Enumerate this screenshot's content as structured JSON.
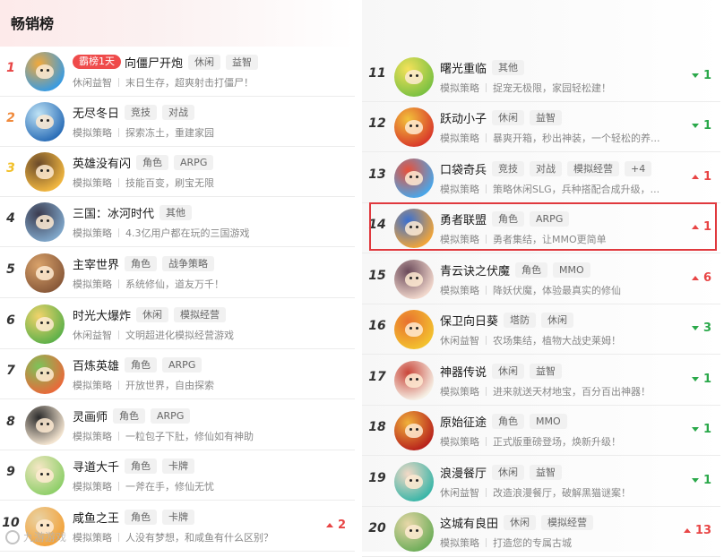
{
  "header": {
    "title": "畅销榜"
  },
  "rankings": [
    {
      "rank": "1",
      "badge": "霸榜1天",
      "name": "向僵尸开炮",
      "tags": [
        "休闲",
        "益智"
      ],
      "category": "休闲益智",
      "desc": "末日生存，超爽射击打僵尸！",
      "trend": null,
      "icon_colors": [
        "#3a9be0",
        "#f2a93b"
      ]
    },
    {
      "rank": "2",
      "badge": null,
      "name": "无尽冬日",
      "tags": [
        "竞技",
        "对战"
      ],
      "category": "模拟策略",
      "desc": "探索冻土，重建家园",
      "trend": null,
      "icon_colors": [
        "#2c6fb8",
        "#bfe3f5"
      ]
    },
    {
      "rank": "3",
      "badge": null,
      "name": "英雄没有闪",
      "tags": [
        "角色",
        "ARPG"
      ],
      "category": "模拟策略",
      "desc": "技能百变，刷宝无限",
      "trend": null,
      "icon_colors": [
        "#f0b640",
        "#6b4a2a"
      ]
    },
    {
      "rank": "4",
      "badge": null,
      "name": "三国：冰河时代",
      "tags": [
        "其他"
      ],
      "category": "模拟策略",
      "desc": "4.3亿用户都在玩的三国游戏",
      "trend": null,
      "icon_colors": [
        "#7fa6c9",
        "#3b3b4f"
      ]
    },
    {
      "rank": "5",
      "badge": null,
      "name": "主宰世界",
      "tags": [
        "角色",
        "战争策略"
      ],
      "category": "模拟策略",
      "desc": "系统修仙，道友万千！",
      "trend": null,
      "icon_colors": [
        "#8a5a3a",
        "#d9a26a"
      ]
    },
    {
      "rank": "6",
      "badge": null,
      "name": "时光大爆炸",
      "tags": [
        "休闲",
        "模拟经营"
      ],
      "category": "休闲益智",
      "desc": "文明超进化模拟经营游戏",
      "trend": null,
      "icon_colors": [
        "#5fb14a",
        "#f2d36b"
      ]
    },
    {
      "rank": "7",
      "badge": null,
      "name": "百炼英雄",
      "tags": [
        "角色",
        "ARPG"
      ],
      "category": "模拟策略",
      "desc": "开放世界，自由探索",
      "trend": null,
      "icon_colors": [
        "#e86a3a",
        "#7cc35a"
      ]
    },
    {
      "rank": "8",
      "badge": null,
      "name": "灵画师",
      "tags": [
        "角色",
        "ARPG"
      ],
      "category": "模拟策略",
      "desc": "一粒包子下肚，修仙如有神助",
      "trend": null,
      "icon_colors": [
        "#f3e4d0",
        "#2b2b2b"
      ]
    },
    {
      "rank": "9",
      "badge": null,
      "name": "寻道大千",
      "tags": [
        "角色",
        "卡牌"
      ],
      "category": "模拟策略",
      "desc": "一斧在手，修仙无忧",
      "trend": null,
      "icon_colors": [
        "#8fcf6a",
        "#f6e7c5"
      ]
    },
    {
      "rank": "10",
      "badge": null,
      "name": "咸鱼之王",
      "tags": [
        "角色",
        "卡牌"
      ],
      "category": "模拟策略",
      "desc": "人没有梦想，和咸鱼有什么区别？",
      "trend": {
        "dir": "up",
        "value": "2"
      },
      "icon_colors": [
        "#f2a23b",
        "#e9d2a3"
      ]
    },
    {
      "rank": "11",
      "badge": null,
      "name": "曙光重临",
      "tags": [
        "其他"
      ],
      "category": "模拟策略",
      "desc": "捉宠无极限，家园轻松建！",
      "trend": {
        "dir": "down",
        "value": "1"
      },
      "icon_colors": [
        "#7cc142",
        "#f5e25a"
      ]
    },
    {
      "rank": "12",
      "badge": null,
      "name": "跃动小子",
      "tags": [
        "休闲",
        "益智"
      ],
      "category": "模拟策略",
      "desc": "暴爽开箱，秒出神装，一个轻松的养...",
      "trend": {
        "dir": "down",
        "value": "1"
      },
      "icon_colors": [
        "#d93a2a",
        "#f2c23b"
      ]
    },
    {
      "rank": "13",
      "badge": null,
      "name": "口袋奇兵",
      "tags": [
        "竞技",
        "对战",
        "模拟经营",
        "+4"
      ],
      "category": "模拟策略",
      "desc": "策略休闲SLG，兵种搭配合成升级，...",
      "trend": {
        "dir": "up",
        "value": "1"
      },
      "icon_colors": [
        "#4aa6e8",
        "#e8503a"
      ]
    },
    {
      "rank": "14",
      "badge": null,
      "name": "勇者联盟",
      "tags": [
        "角色",
        "ARPG"
      ],
      "category": "模拟策略",
      "desc": "勇者集结，让MMO更简单",
      "trend": {
        "dir": "up",
        "value": "1"
      },
      "icon_colors": [
        "#f0a53a",
        "#3a6fd0"
      ]
    },
    {
      "rank": "15",
      "badge": null,
      "name": "青云诀之伏魔",
      "tags": [
        "角色",
        "MMO"
      ],
      "category": "模拟策略",
      "desc": "降妖伏魔，体验最真实的修仙",
      "trend": {
        "dir": "up",
        "value": "6"
      },
      "icon_colors": [
        "#f1d7cc",
        "#6b4a5a"
      ]
    },
    {
      "rank": "16",
      "badge": null,
      "name": "保卫向日葵",
      "tags": [
        "塔防",
        "休闲"
      ],
      "category": "休闲益智",
      "desc": "农场集结，植物大战史莱姆！",
      "trend": {
        "dir": "down",
        "value": "3"
      },
      "icon_colors": [
        "#f3c12f",
        "#e8712f"
      ]
    },
    {
      "rank": "17",
      "badge": null,
      "name": "神器传说",
      "tags": [
        "休闲",
        "益智"
      ],
      "category": "模拟策略",
      "desc": "进来就送天材地宝，百分百出神器！",
      "trend": {
        "dir": "down",
        "value": "1"
      },
      "icon_colors": [
        "#f6efe4",
        "#c9463a"
      ]
    },
    {
      "rank": "18",
      "badge": null,
      "name": "原始征途",
      "tags": [
        "角色",
        "MMO"
      ],
      "category": "模拟策略",
      "desc": "正式版重磅登场，焕新升级！",
      "trend": {
        "dir": "down",
        "value": "1"
      },
      "icon_colors": [
        "#b8231c",
        "#f0b13a"
      ]
    },
    {
      "rank": "19",
      "badge": null,
      "name": "浪漫餐厅",
      "tags": [
        "休闲",
        "益智"
      ],
      "category": "休闲益智",
      "desc": "改造浪漫餐厅，破解黑猫谜案！",
      "trend": {
        "dir": "down",
        "value": "1"
      },
      "icon_colors": [
        "#3bb6a8",
        "#f4d9c6"
      ]
    },
    {
      "rank": "20",
      "badge": null,
      "name": "这城有良田",
      "tags": [
        "休闲",
        "模拟经营"
      ],
      "category": "模拟策略",
      "desc": "打造您的专属古城",
      "trend": {
        "dir": "up",
        "value": "13"
      },
      "icon_colors": [
        "#6fae5a",
        "#e8d7a8"
      ]
    }
  ],
  "watermark": {
    "text": "九游游戏"
  },
  "colors": {
    "up": "#e84545",
    "down": "#2aa84a",
    "badge": "#ef4b4b",
    "highlight": "#e0393e"
  }
}
